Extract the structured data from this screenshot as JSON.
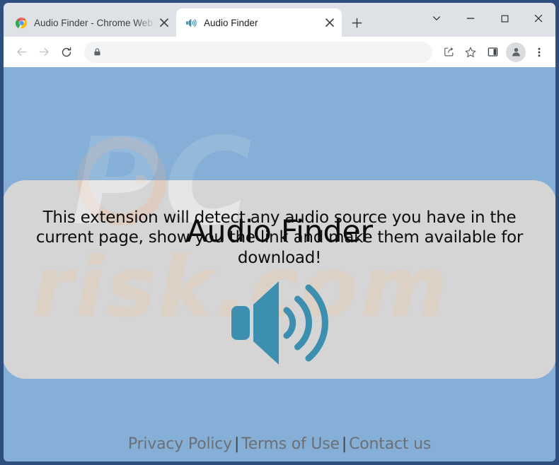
{
  "browser": {
    "tabs": [
      {
        "title": "Audio Finder - Chrome Web Store",
        "favicon": "chrome-webstore-icon",
        "active": false,
        "close_label": "×"
      },
      {
        "title": "Audio Finder",
        "favicon": "speaker-icon",
        "active": true,
        "close_label": "×"
      }
    ],
    "new_tab_label": "+",
    "window_controls": {
      "tab_search": "tab-search-icon",
      "minimize": "minimize-icon",
      "maximize": "maximize-icon",
      "close": "close-icon"
    },
    "toolbar": {
      "back": "back-arrow-icon",
      "forward": "forward-arrow-icon",
      "reload": "reload-icon",
      "omnibox": {
        "lock_icon": "lock-icon",
        "value": "",
        "placeholder": ""
      },
      "share": "share-icon",
      "bookmark": "star-icon",
      "side_panel": "side-panel-icon",
      "profile": "profile-avatar-icon",
      "menu": "three-dot-menu-icon"
    }
  },
  "page": {
    "heading": "Audio Finder",
    "description": "This extension will detect any audio source you have in the current page, show you the link and make them available for download!",
    "hero_icon": "speaker-volume-icon",
    "watermark": {
      "line1": "PC",
      "line2": "risk.com"
    },
    "footer": {
      "links": [
        {
          "label": "Privacy Policy"
        },
        {
          "label": "Terms of Use"
        },
        {
          "label": "Contact us"
        }
      ],
      "separator": "|"
    }
  },
  "colors": {
    "page_background": "#85afd6",
    "card_background": "#d5d5d5",
    "accent_teal": "#3d8fb0",
    "window_border": "#2e4e7e",
    "footer_text": "#6b7075",
    "heading_text": "#0d0d0d"
  }
}
